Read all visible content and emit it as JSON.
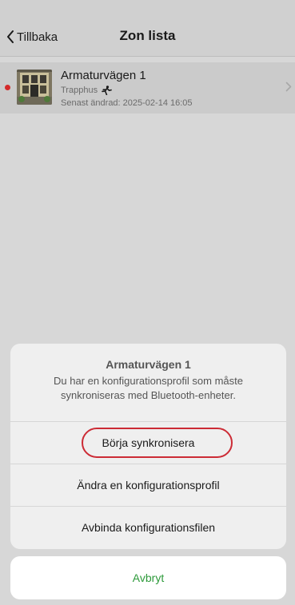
{
  "nav": {
    "back_label": "Tillbaka",
    "title": "Zon lista"
  },
  "zone": {
    "name": "Armaturvägen 1",
    "type": "Trapphus",
    "modified": "Senast ändrad: 2025-02-14 16:05",
    "status_color": "#d42a2a",
    "type_icon": "running-person-icon"
  },
  "sheet": {
    "title": "Armaturvägen 1",
    "message": "Du har en konfigurationsprofil som måste synkroniseras med Bluetooth-enheter.",
    "actions": [
      {
        "label": "Börja synkronisera"
      },
      {
        "label": "Ändra en konfigurationsprofil"
      },
      {
        "label": "Avbinda konfigurationsfilen"
      }
    ],
    "cancel_label": "Avbryt"
  },
  "colors": {
    "accent_green": "#2d9a3a",
    "highlight_red": "#cc2b35"
  }
}
